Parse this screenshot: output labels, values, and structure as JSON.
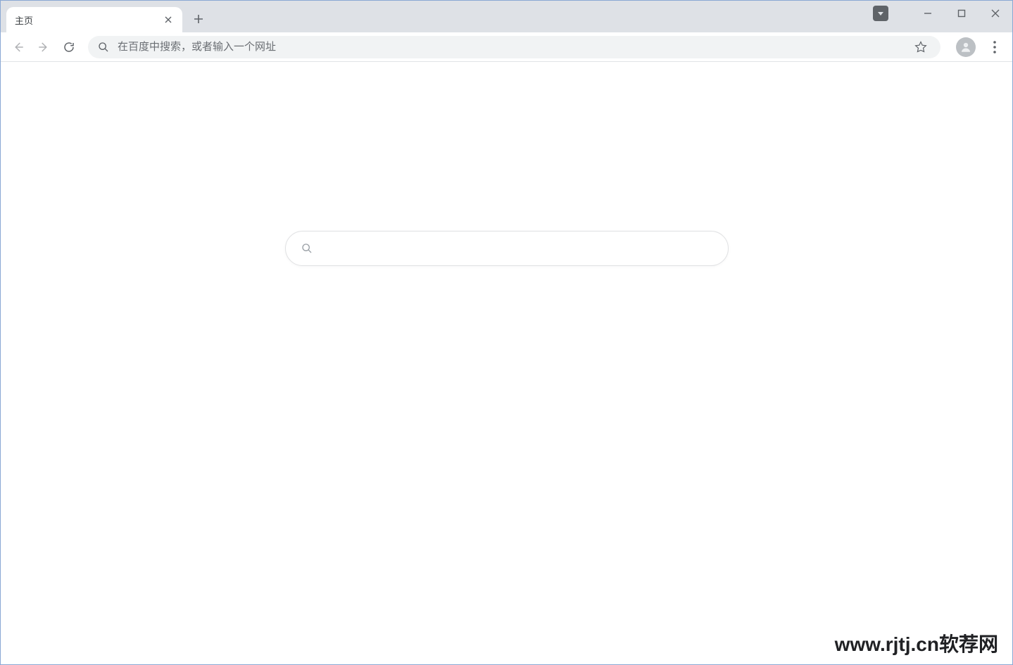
{
  "browser": {
    "tab": {
      "title": "主页"
    },
    "omnibox": {
      "placeholder": "在百度中搜索，或者输入一个网址",
      "value": ""
    }
  },
  "content": {
    "search": {
      "value": ""
    },
    "watermark": "www.rjtj.cn软荐网"
  }
}
